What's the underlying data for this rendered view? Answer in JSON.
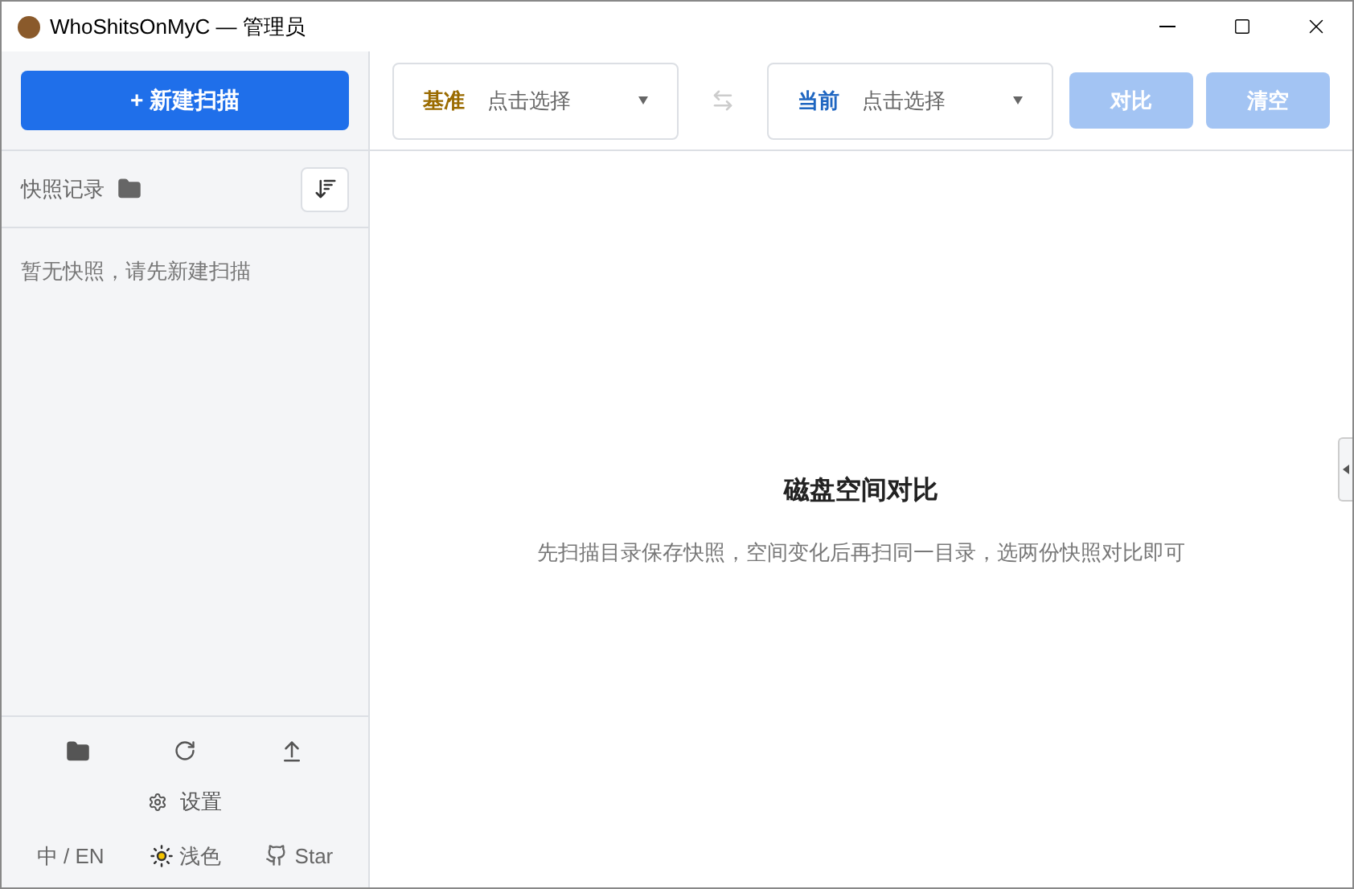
{
  "window": {
    "title": "WhoShitsOnMyC — 管理员"
  },
  "sidebar": {
    "new_scan_button": "+ 新建扫描",
    "snapshots_label": "快照记录",
    "empty_text": "暂无快照，请先新建扫描",
    "settings": "设置",
    "language": "中 / EN",
    "theme": "浅色",
    "star": "Star"
  },
  "toolbar": {
    "selectors": [
      {
        "label": "基准",
        "color": "#9a6b00",
        "placeholder": "点击选择"
      },
      {
        "label": "当前",
        "color": "#1f66c1",
        "placeholder": "点击选择"
      }
    ],
    "buttons": [
      {
        "label": "对比",
        "disabled": true
      },
      {
        "label": "清空",
        "disabled": true
      }
    ]
  },
  "main": {
    "title": "磁盘空间对比",
    "subtitle": "先扫描目录保存快照，空间变化后再扫同一目录，选两份快照对比即可"
  }
}
